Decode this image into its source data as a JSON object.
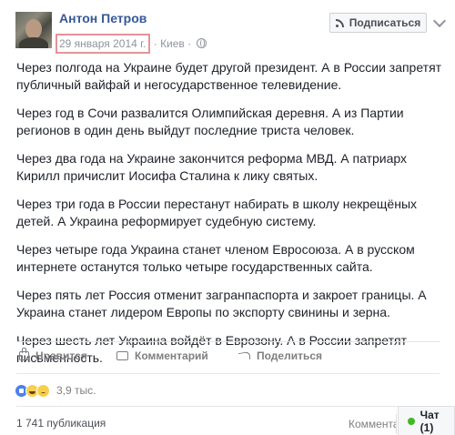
{
  "post": {
    "author": "Антон Петров",
    "date": "29 января 2014 г.",
    "location_separator": "·",
    "location": "Киев",
    "subscribe_label": "Подписаться",
    "paragraphs": [
      "Через полгода на Украине будет другой президент. А в России запретят публичный вайфай и негосударственное телевидение.",
      "Через год в Сочи развалится Олимпийская деревня. А из Партии регионов в один день выйдут последние триста человек.",
      "Через два года на Украине закончится реформа МВД. А патриарх Кирилл причислит Иосифа Сталина к лику святых.",
      "Через три года в России перестанут набирать в школу некрещёных детей. А Украина реформирует судебную систему.",
      "Через четыре года Украина станет членом Евросоюза. А в русском интернете останутся только четыре государственных сайта.",
      "Через пять лет Россия отменит загранпаспорта и закроет границы. А Украина станет лидером Европы по экспорту свинины и зерна.",
      "Через шесть лет Украина войдёт в Еврозону. А в России запретят письменность."
    ]
  },
  "actions": {
    "like": "Нравится",
    "comment": "Комментарий",
    "share": "Поделиться"
  },
  "reactions": {
    "icons": [
      "like-icon",
      "haha-icon",
      "sad-icon"
    ],
    "count": "3,9 тыс."
  },
  "footer": {
    "publications": "1 741 публикация",
    "comment_fragment": "Комментарий",
    "chat_label": "Чат (1)"
  },
  "colors": {
    "link_blue": "#365899",
    "date_highlight": "#e4939a",
    "online_green": "#42b72a"
  }
}
